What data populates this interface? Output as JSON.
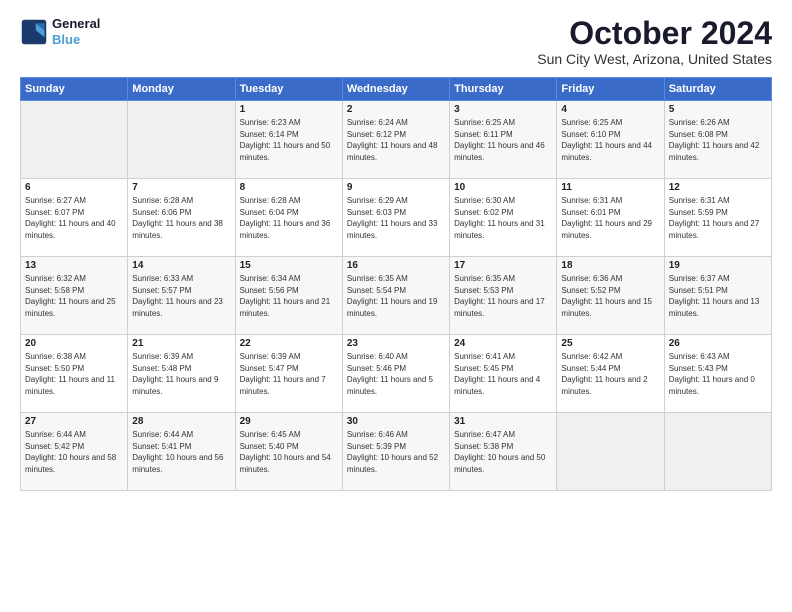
{
  "logo": {
    "line1": "General",
    "line2": "Blue"
  },
  "title": "October 2024",
  "subtitle": "Sun City West, Arizona, United States",
  "weekdays": [
    "Sunday",
    "Monday",
    "Tuesday",
    "Wednesday",
    "Thursday",
    "Friday",
    "Saturday"
  ],
  "weeks": [
    [
      {
        "day": "",
        "info": ""
      },
      {
        "day": "",
        "info": ""
      },
      {
        "day": "1",
        "info": "Sunrise: 6:23 AM\nSunset: 6:14 PM\nDaylight: 11 hours and 50 minutes."
      },
      {
        "day": "2",
        "info": "Sunrise: 6:24 AM\nSunset: 6:12 PM\nDaylight: 11 hours and 48 minutes."
      },
      {
        "day": "3",
        "info": "Sunrise: 6:25 AM\nSunset: 6:11 PM\nDaylight: 11 hours and 46 minutes."
      },
      {
        "day": "4",
        "info": "Sunrise: 6:25 AM\nSunset: 6:10 PM\nDaylight: 11 hours and 44 minutes."
      },
      {
        "day": "5",
        "info": "Sunrise: 6:26 AM\nSunset: 6:08 PM\nDaylight: 11 hours and 42 minutes."
      }
    ],
    [
      {
        "day": "6",
        "info": "Sunrise: 6:27 AM\nSunset: 6:07 PM\nDaylight: 11 hours and 40 minutes."
      },
      {
        "day": "7",
        "info": "Sunrise: 6:28 AM\nSunset: 6:06 PM\nDaylight: 11 hours and 38 minutes."
      },
      {
        "day": "8",
        "info": "Sunrise: 6:28 AM\nSunset: 6:04 PM\nDaylight: 11 hours and 36 minutes."
      },
      {
        "day": "9",
        "info": "Sunrise: 6:29 AM\nSunset: 6:03 PM\nDaylight: 11 hours and 33 minutes."
      },
      {
        "day": "10",
        "info": "Sunrise: 6:30 AM\nSunset: 6:02 PM\nDaylight: 11 hours and 31 minutes."
      },
      {
        "day": "11",
        "info": "Sunrise: 6:31 AM\nSunset: 6:01 PM\nDaylight: 11 hours and 29 minutes."
      },
      {
        "day": "12",
        "info": "Sunrise: 6:31 AM\nSunset: 5:59 PM\nDaylight: 11 hours and 27 minutes."
      }
    ],
    [
      {
        "day": "13",
        "info": "Sunrise: 6:32 AM\nSunset: 5:58 PM\nDaylight: 11 hours and 25 minutes."
      },
      {
        "day": "14",
        "info": "Sunrise: 6:33 AM\nSunset: 5:57 PM\nDaylight: 11 hours and 23 minutes."
      },
      {
        "day": "15",
        "info": "Sunrise: 6:34 AM\nSunset: 5:56 PM\nDaylight: 11 hours and 21 minutes."
      },
      {
        "day": "16",
        "info": "Sunrise: 6:35 AM\nSunset: 5:54 PM\nDaylight: 11 hours and 19 minutes."
      },
      {
        "day": "17",
        "info": "Sunrise: 6:35 AM\nSunset: 5:53 PM\nDaylight: 11 hours and 17 minutes."
      },
      {
        "day": "18",
        "info": "Sunrise: 6:36 AM\nSunset: 5:52 PM\nDaylight: 11 hours and 15 minutes."
      },
      {
        "day": "19",
        "info": "Sunrise: 6:37 AM\nSunset: 5:51 PM\nDaylight: 11 hours and 13 minutes."
      }
    ],
    [
      {
        "day": "20",
        "info": "Sunrise: 6:38 AM\nSunset: 5:50 PM\nDaylight: 11 hours and 11 minutes."
      },
      {
        "day": "21",
        "info": "Sunrise: 6:39 AM\nSunset: 5:48 PM\nDaylight: 11 hours and 9 minutes."
      },
      {
        "day": "22",
        "info": "Sunrise: 6:39 AM\nSunset: 5:47 PM\nDaylight: 11 hours and 7 minutes."
      },
      {
        "day": "23",
        "info": "Sunrise: 6:40 AM\nSunset: 5:46 PM\nDaylight: 11 hours and 5 minutes."
      },
      {
        "day": "24",
        "info": "Sunrise: 6:41 AM\nSunset: 5:45 PM\nDaylight: 11 hours and 4 minutes."
      },
      {
        "day": "25",
        "info": "Sunrise: 6:42 AM\nSunset: 5:44 PM\nDaylight: 11 hours and 2 minutes."
      },
      {
        "day": "26",
        "info": "Sunrise: 6:43 AM\nSunset: 5:43 PM\nDaylight: 11 hours and 0 minutes."
      }
    ],
    [
      {
        "day": "27",
        "info": "Sunrise: 6:44 AM\nSunset: 5:42 PM\nDaylight: 10 hours and 58 minutes."
      },
      {
        "day": "28",
        "info": "Sunrise: 6:44 AM\nSunset: 5:41 PM\nDaylight: 10 hours and 56 minutes."
      },
      {
        "day": "29",
        "info": "Sunrise: 6:45 AM\nSunset: 5:40 PM\nDaylight: 10 hours and 54 minutes."
      },
      {
        "day": "30",
        "info": "Sunrise: 6:46 AM\nSunset: 5:39 PM\nDaylight: 10 hours and 52 minutes."
      },
      {
        "day": "31",
        "info": "Sunrise: 6:47 AM\nSunset: 5:38 PM\nDaylight: 10 hours and 50 minutes."
      },
      {
        "day": "",
        "info": ""
      },
      {
        "day": "",
        "info": ""
      }
    ]
  ]
}
